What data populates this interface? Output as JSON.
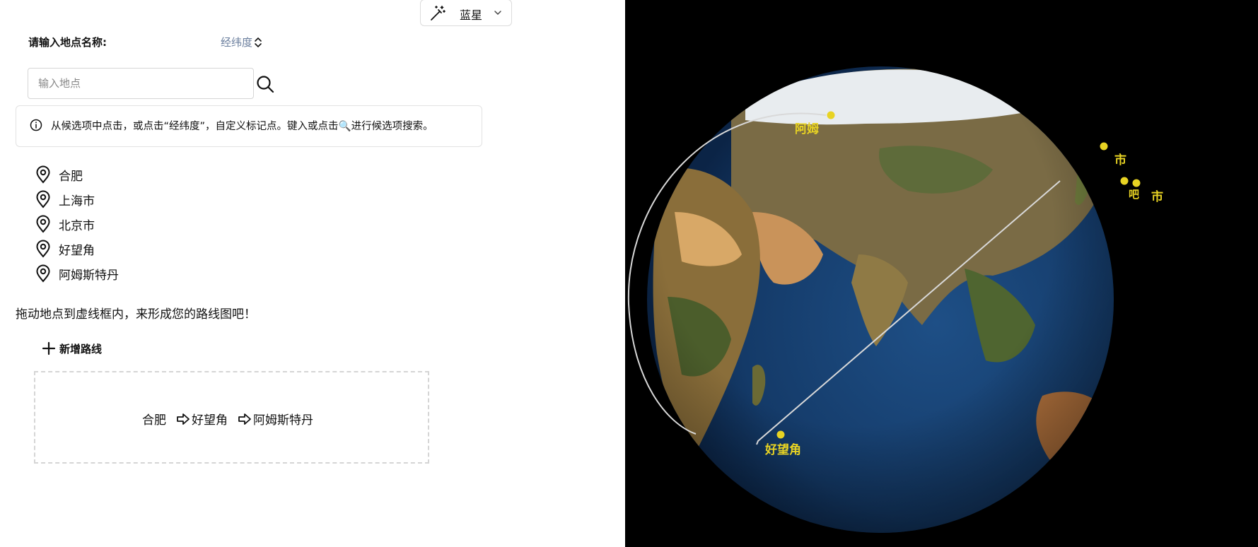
{
  "theme_select": {
    "value": "蓝星",
    "wand_icon": "magic-wand-icon",
    "chevron_icon": "chevron-down-icon"
  },
  "search": {
    "label": "请输入地点名称:",
    "coord_toggle": "经纬度",
    "placeholder": "输入地点",
    "value": ""
  },
  "info": {
    "text": "从候选项中点击，或点击“经纬度”，自定义标记点。键入或点击🔍进行候选项搜索。"
  },
  "places": [
    "合肥",
    "上海市",
    "北京市",
    "好望角",
    "阿姆斯特丹"
  ],
  "drag_hint": "拖动地点到虚线框内，来形成您的路线图吧！",
  "add_route": {
    "label": "新增路线"
  },
  "route": {
    "stops": [
      "合肥",
      "好望角",
      "阿姆斯特丹"
    ]
  },
  "globe": {
    "labels": [
      {
        "text": "阿姆"
      },
      {
        "text": "市"
      },
      {
        "text": "吧"
      },
      {
        "text": "市"
      },
      {
        "text": "好望角"
      }
    ],
    "marker_color": "#e8d323",
    "route_color": "#d9d9d9"
  },
  "colors": {
    "accent_link": "#6b7f9e",
    "border": "#d6d6d6",
    "dashed_border": "#d5d5d5"
  }
}
